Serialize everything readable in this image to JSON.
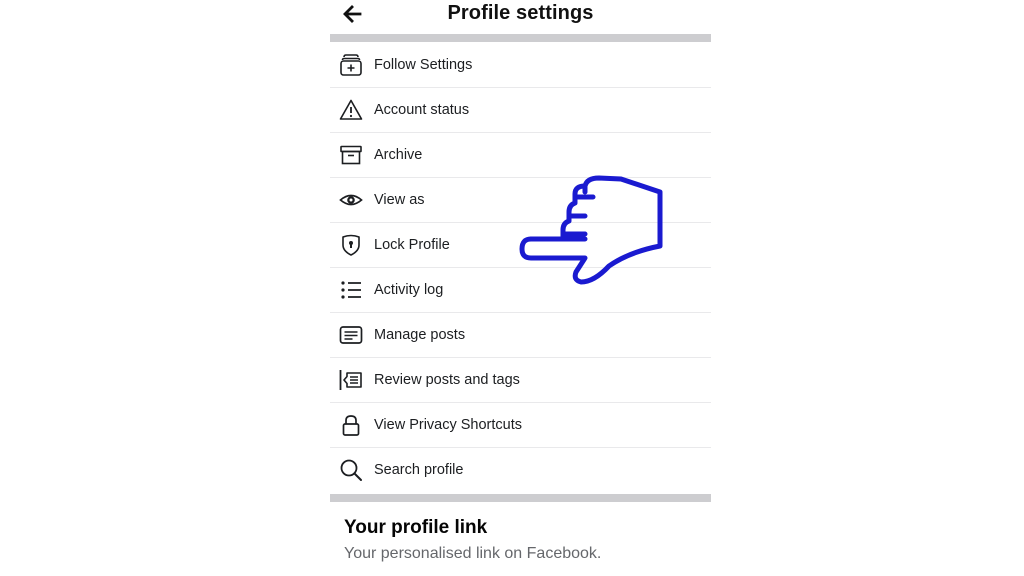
{
  "header": {
    "back_icon": "arrow-left-icon",
    "title": "Profile settings"
  },
  "menu": {
    "items": [
      {
        "label": "Follow Settings",
        "icon": "follow-settings-icon"
      },
      {
        "label": "Account status",
        "icon": "warning-triangle-icon"
      },
      {
        "label": "Archive",
        "icon": "archive-box-icon"
      },
      {
        "label": "View as",
        "icon": "eye-icon"
      },
      {
        "label": "Lock Profile",
        "icon": "shield-lock-icon"
      },
      {
        "label": "Activity log",
        "icon": "list-icon"
      },
      {
        "label": "Manage posts",
        "icon": "posts-icon"
      },
      {
        "label": "Review posts and tags",
        "icon": "review-posts-icon"
      },
      {
        "label": "View Privacy Shortcuts",
        "icon": "lock-icon"
      },
      {
        "label": "Search profile",
        "icon": "search-icon"
      }
    ]
  },
  "profile_link": {
    "title": "Your profile link",
    "subtitle": "Your personalised link on Facebook."
  },
  "overlay": {
    "icon": "pointing-hand-icon",
    "color": "#1a1ad0"
  },
  "colors": {
    "divider": "#cdcdd0",
    "text": "#1c1e21",
    "secondary_text": "#65676b"
  }
}
